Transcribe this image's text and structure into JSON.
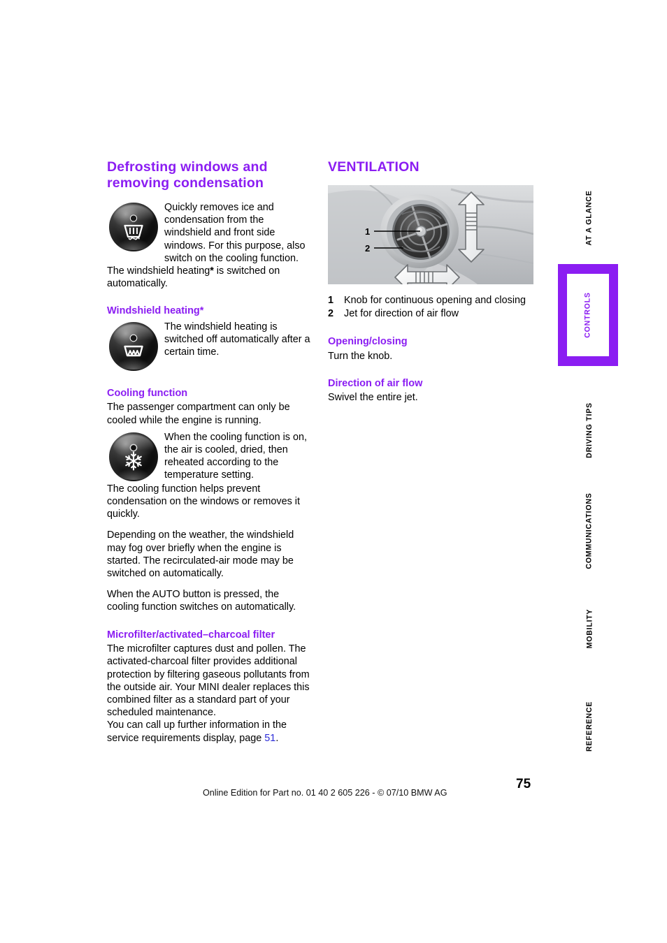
{
  "page": {
    "number": "75",
    "footer_note": "Online Edition for Part no. 01 40 2 605 226 - © 07/10  BMW AG",
    "accent_color": "#8b1df2",
    "link_color": "#2b2bd8"
  },
  "left_column": {
    "defrost": {
      "heading": "Defrosting windows and removing condensation",
      "icon": "defrost-windshield-icon",
      "icon_text": "Quickly removes ice and condensation from the windshield and front side windows.\nFor this purpose, also switch on the cooling function.",
      "paragraph": "The windshield heating* is switched on automatically.",
      "paragraph_pre": "The windshield heating",
      "paragraph_star": "*",
      "paragraph_post": " is switched on automatically."
    },
    "windshield_heating": {
      "heading": "Windshield heating*",
      "icon": "windshield-heating-icon",
      "icon_text": "The windshield heating is switched off automatically after a certain time."
    },
    "cooling": {
      "heading": "Cooling function",
      "intro": "The passenger compartment can only be cooled while the engine is running.",
      "icon": "snowflake-cooling-icon",
      "icon_text": "When the cooling function is on, the air is cooled, dried, then reheated according to the temperature setting.",
      "paragraphs": [
        "The cooling function helps prevent condensation on the windows or removes it quickly.",
        "Depending on the weather, the windshield may fog over briefly when the engine is started. The recirculated-air mode may be switched on automatically.",
        "When the AUTO button is pressed, the cooling function switches on automatically."
      ]
    },
    "microfilter": {
      "heading": "Microfilter/activated–charcoal filter",
      "paragraph": "The microfilter captures dust and pollen. The activated-charcoal filter provides additional protection by filtering gaseous pollutants from the outside air. Your MINI dealer replaces this combined filter as a standard part of your scheduled maintenance.",
      "reference_pre": "You can call up further information in the service requirements display, page ",
      "reference_page": "51",
      "reference_post": "."
    }
  },
  "right_column": {
    "heading": "VENTILATION",
    "figure": {
      "name": "air-vent-diagram",
      "callouts": [
        {
          "num": "1"
        },
        {
          "num": "2"
        }
      ]
    },
    "legend": [
      {
        "num": "1",
        "label": "Knob for continuous opening and closing"
      },
      {
        "num": "2",
        "label": "Jet for direction of air flow"
      }
    ],
    "opening_closing": {
      "heading": "Opening/closing",
      "text": "Turn the knob."
    },
    "direction_of_air_flow": {
      "heading": "Direction of air flow",
      "text": "Swivel the entire jet."
    }
  },
  "side_tabs": [
    {
      "label": "AT A GLANCE",
      "active": false
    },
    {
      "label": "CONTROLS",
      "active": true
    },
    {
      "label": "DRIVING TIPS",
      "active": false
    },
    {
      "label": "COMMUNICATIONS",
      "active": false
    },
    {
      "label": "MOBILITY",
      "active": false
    },
    {
      "label": "REFERENCE",
      "active": false
    }
  ]
}
